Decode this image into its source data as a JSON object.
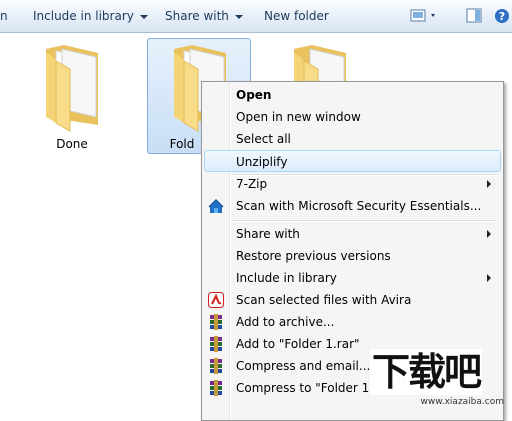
{
  "toolbar": {
    "cut_left": "n",
    "include_in_library": "Include in library",
    "share_with": "Share with",
    "new_folder": "New folder"
  },
  "folders": [
    {
      "label": "Done"
    },
    {
      "label": "Fold"
    },
    {
      "label": ""
    }
  ],
  "menu": {
    "items": [
      {
        "label": "Open"
      },
      {
        "label": "Open in new window"
      },
      {
        "label": "Select all"
      },
      {
        "label": "Unziplify"
      },
      {
        "label": "7-Zip"
      },
      {
        "label": "Scan with Microsoft Security Essentials..."
      },
      {
        "label": "Share with"
      },
      {
        "label": "Restore previous versions"
      },
      {
        "label": "Include in library"
      },
      {
        "label": "Scan selected files with Avira"
      },
      {
        "label": "Add to archive..."
      },
      {
        "label": "Add to \"Folder 1.rar\""
      },
      {
        "label": "Compress and email..."
      },
      {
        "label": "Compress to \"Folder 1.rar"
      }
    ]
  },
  "watermark": {
    "logo": "下载吧",
    "url": "www.xiazaiba.com"
  },
  "colors": {
    "selection": "#c8def6",
    "menu_bg": "#f5f5f5",
    "highlight_border": "#a8d8f5",
    "folder_yellow": "#f5d478"
  }
}
